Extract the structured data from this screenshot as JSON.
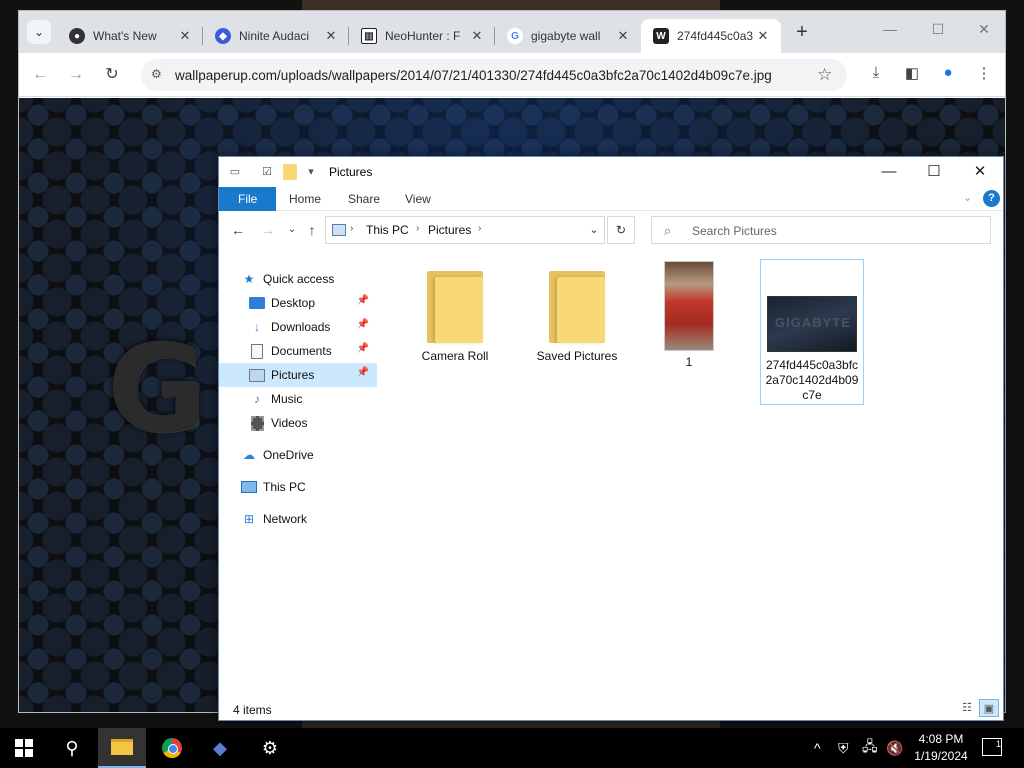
{
  "browser": {
    "tabs": [
      {
        "label": "What's New",
        "favicon": "github-icon",
        "color": "#333333"
      },
      {
        "label": "Ninite Audaci",
        "favicon": "ninite-icon",
        "color": "#3b5bdb"
      },
      {
        "label": "NeoHunter : F",
        "favicon": "archive-icon",
        "color": "#222222"
      },
      {
        "label": "gigabyte wall",
        "favicon": "google-icon",
        "color": "#4285f4"
      },
      {
        "label": "274fd445c0a3",
        "favicon": "wallpaperup-icon",
        "color": "#222222"
      }
    ],
    "url": "wallpaperup.com/uploads/wallpapers/2014/07/21/401330/274fd445c0a3bfc2a70c1402d4b09c7e.jpg",
    "page_logo_text": "G"
  },
  "explorer": {
    "title": "Pictures",
    "ribbon_tabs": [
      "File",
      "Home",
      "Share",
      "View"
    ],
    "breadcrumb": [
      "This PC",
      "Pictures"
    ],
    "search_placeholder": "Search Pictures",
    "nav": {
      "quick_access": "Quick access",
      "desktop": "Desktop",
      "downloads": "Downloads",
      "documents": "Documents",
      "pictures": "Pictures",
      "music": "Music",
      "videos": "Videos",
      "onedrive": "OneDrive",
      "this_pc": "This PC",
      "network": "Network"
    },
    "items": [
      {
        "name": "Camera Roll",
        "kind": "folder"
      },
      {
        "name": "Saved Pictures",
        "kind": "folder"
      },
      {
        "name": "1",
        "kind": "image"
      },
      {
        "name": "274fd445c0a3bfc2a70c1402d4b09c7e",
        "kind": "image",
        "thumb_text": "GIGABYTE"
      }
    ],
    "status": "4 items"
  },
  "taskbar": {
    "time": "4:08 PM",
    "date": "1/19/2024",
    "notification_count": "1"
  }
}
